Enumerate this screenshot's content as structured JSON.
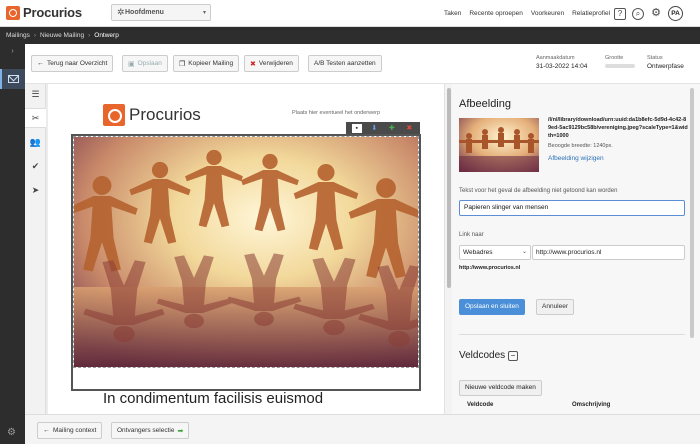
{
  "app": {
    "brand": "Procurios"
  },
  "header": {
    "main_menu_label": "Hoofdmenu",
    "links": [
      "Taken",
      "Recente oproepen",
      "Voorkeuren",
      "Relatieprofiel"
    ],
    "avatar_initials": "PA"
  },
  "breadcrumb": [
    "Mailings",
    "Nieuwe Mailing",
    "Ontwerp"
  ],
  "toolbar": {
    "back_label": "Terug naar Overzicht",
    "save_label": "Opslaan",
    "copy_label": "Kopieer Mailing",
    "delete_label": "Verwijderen",
    "ab_label": "A/B Testen aanzetten",
    "created_label": "Aanmaakdatum",
    "created_value": "31-03-2022 14:04",
    "size_label": "Grootte",
    "size_fraction": 0.0,
    "status_label": "Status",
    "status_value": "Ontwerpfase"
  },
  "editor": {
    "logo_text": "Procurios",
    "subject_hint": "Plaats hier eventueel het onderwerp",
    "heading": "In condimentum facilisis euismod"
  },
  "panel": {
    "title": "Afbeelding",
    "image_url": "/l/nl/library/download/urn:uuid:da1b8efc-5d9d-4c42-89ed-5ac9129bc58b/vereniging.jpeg?scaleType=1&width=1000",
    "required_width": "Beoogde breedte: 1240px.",
    "change_image": "Afbeelding wijzigen",
    "alt_label": "Tekst voor het geval de afbeelding niet getoond kan worden",
    "alt_value": "Papieren slinger van mensen",
    "link_label": "Link naar",
    "link_type": "Webadres",
    "link_value": "http://www.procurios.nl",
    "link_preview": "http://www.procurios.nl",
    "save_close": "Opslaan en sluiten",
    "cancel": "Annuleer",
    "vc_title": "Veldcodes",
    "vc_toggle": "−",
    "vc_new": "Nieuwe veldcode maken",
    "vc_cols": [
      "Veldcode",
      "Omschrijving"
    ]
  },
  "footer": {
    "context_label": "Mailing context",
    "recipients_label": "Ontvangers selectie"
  }
}
